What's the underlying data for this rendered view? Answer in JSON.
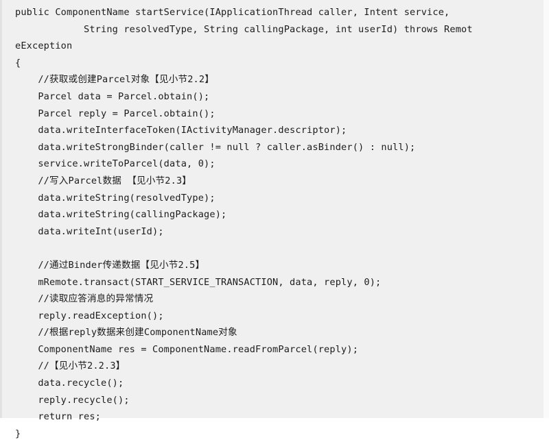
{
  "code_block": {
    "language": "java",
    "background_color": "#f0f0f0",
    "text_color": "#1c1c1c",
    "left_border_color": "#e2e2e2",
    "lines": [
      {
        "indent": 0,
        "text": "public ComponentName startService(IApplicationThread caller, Intent service,"
      },
      {
        "indent": 0,
        "text": "            String resolvedType, String callingPackage, int userId) throws Remot"
      },
      {
        "indent": 0,
        "text": "eException"
      },
      {
        "indent": 0,
        "text": "{"
      },
      {
        "indent": 4,
        "text": "    //获取或创建Parcel对象【见小节2.2】"
      },
      {
        "indent": 4,
        "text": "    Parcel data = Parcel.obtain();"
      },
      {
        "indent": 4,
        "text": "    Parcel reply = Parcel.obtain();"
      },
      {
        "indent": 4,
        "text": "    data.writeInterfaceToken(IActivityManager.descriptor);"
      },
      {
        "indent": 4,
        "text": "    data.writeStrongBinder(caller != null ? caller.asBinder() : null);"
      },
      {
        "indent": 4,
        "text": "    service.writeToParcel(data, 0);"
      },
      {
        "indent": 4,
        "text": "    //写入Parcel数据 【见小节2.3】"
      },
      {
        "indent": 4,
        "text": "    data.writeString(resolvedType);"
      },
      {
        "indent": 4,
        "text": "    data.writeString(callingPackage);"
      },
      {
        "indent": 4,
        "text": "    data.writeInt(userId);"
      },
      {
        "indent": 0,
        "text": ""
      },
      {
        "indent": 4,
        "text": "    //通过Binder传递数据【见小节2.5】"
      },
      {
        "indent": 4,
        "text": "    mRemote.transact(START_SERVICE_TRANSACTION, data, reply, 0);"
      },
      {
        "indent": 4,
        "text": "    //读取应答消息的异常情况"
      },
      {
        "indent": 4,
        "text": "    reply.readException();"
      },
      {
        "indent": 4,
        "text": "    //根据reply数据来创建ComponentName对象"
      },
      {
        "indent": 4,
        "text": "    ComponentName res = ComponentName.readFromParcel(reply);"
      },
      {
        "indent": 4,
        "text": "    //【见小节2.2.3】"
      },
      {
        "indent": 4,
        "text": "    data.recycle();"
      },
      {
        "indent": 4,
        "text": "    reply.recycle();"
      },
      {
        "indent": 4,
        "text": "    return res;"
      },
      {
        "indent": 0,
        "text": "}"
      }
    ]
  }
}
